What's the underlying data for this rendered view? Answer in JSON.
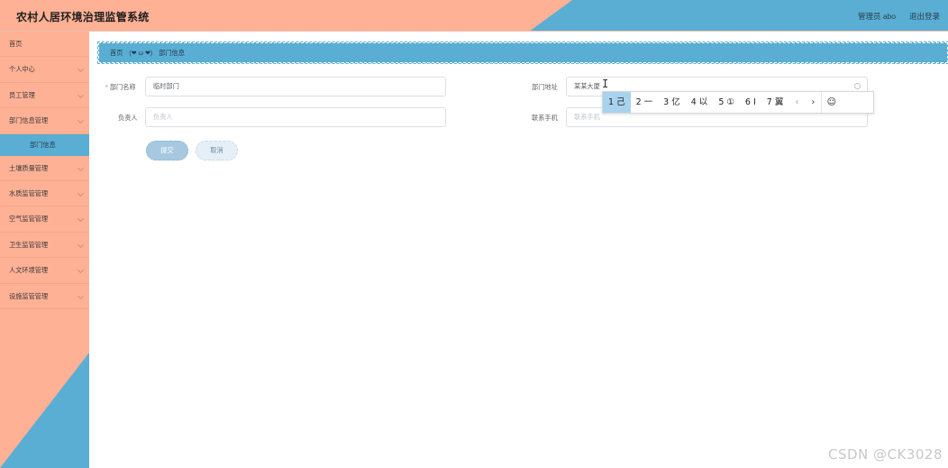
{
  "app": {
    "title": "农村人居环境治理监管系统",
    "user": "管理员 abo",
    "logout": "退出登录"
  },
  "colors": {
    "peach": "#ffb195",
    "blue": "#5aaed3",
    "required": "#f56c6c"
  },
  "sidebar": {
    "items": [
      {
        "label": "首页",
        "has_chevron": false
      },
      {
        "label": "个人中心",
        "has_chevron": true
      },
      {
        "label": "员工管理",
        "has_chevron": true
      },
      {
        "label": "部门信息管理",
        "has_chevron": true
      },
      {
        "label": "部门信息",
        "sub": true
      },
      {
        "label": "土壤质量管理",
        "has_chevron": true
      },
      {
        "label": "水质监管管理",
        "has_chevron": true
      },
      {
        "label": "空气监管管理",
        "has_chevron": true
      },
      {
        "label": "卫生监管管理",
        "has_chevron": true
      },
      {
        "label": "人文环境管理",
        "has_chevron": true
      },
      {
        "label": "设施监管管理",
        "has_chevron": true
      }
    ]
  },
  "breadcrumb": {
    "home": "首页",
    "separator": "(❤ ω ❤)",
    "current": "部门信息"
  },
  "form": {
    "dept_name": {
      "label": "部门名称",
      "value": "临时部门"
    },
    "dept_address": {
      "label": "部门地址",
      "value": "某某大厦"
    },
    "leader": {
      "label": "负责人",
      "placeholder": "负责人"
    },
    "phone": {
      "label": "联系手机",
      "placeholder": "联系手机"
    },
    "submit": "提交",
    "cancel": "取消"
  },
  "ime": {
    "candidates": [
      "1 己",
      "2 一",
      "3 亿",
      "4 以",
      "5 ①",
      "6 I",
      "7 翼"
    ],
    "active_index": 0,
    "prev_icon": "chevron-left-icon",
    "next_icon": "chevron-right-icon",
    "emoji": "☺"
  },
  "watermark": "CSDN @CK3028"
}
